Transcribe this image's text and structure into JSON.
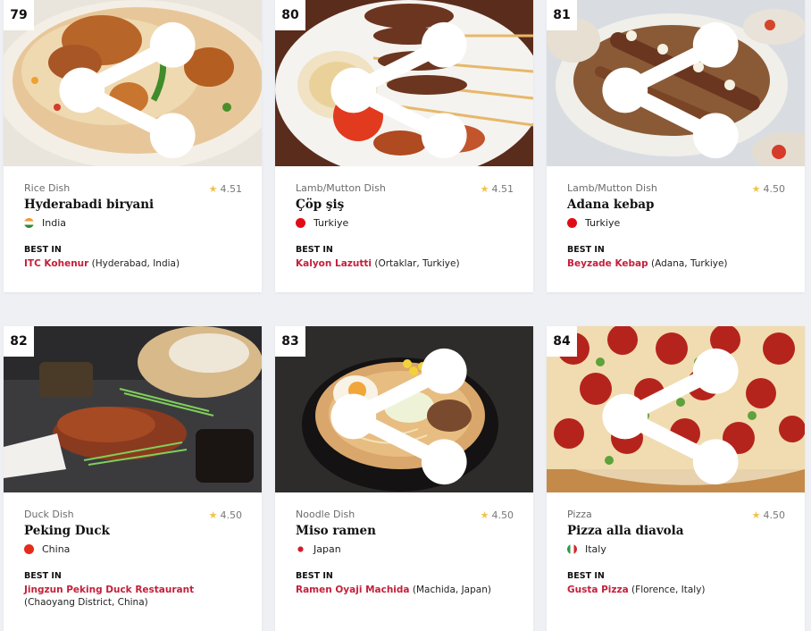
{
  "share_icon": "share-icon",
  "star_icon": "star-icon",
  "colors": {
    "accent": "#c4203a",
    "star": "#f2c24a"
  },
  "best_in_label": "BEST IN",
  "cards": [
    {
      "rank": "79",
      "category": "Rice Dish",
      "rating": "4.51",
      "name": "Hyderabadi biryani",
      "country": "India",
      "restaurant": "ITC Kohenur",
      "location": " (Hyderabad, India)"
    },
    {
      "rank": "80",
      "category": "Lamb/Mutton Dish",
      "rating": "4.51",
      "name": "Çöp şiş",
      "country": "Turkiye",
      "restaurant": "Kalyon Lazutti",
      "location": " (Ortaklar, Turkiye)"
    },
    {
      "rank": "81",
      "category": "Lamb/Mutton Dish",
      "rating": "4.50",
      "name": "Adana kebap",
      "country": "Turkiye",
      "restaurant": "Beyzade Kebap",
      "location": " (Adana, Turkiye)"
    },
    {
      "rank": "82",
      "category": "Duck Dish",
      "rating": "4.50",
      "name": "Peking Duck",
      "country": "China",
      "restaurant": "Jingzun Peking Duck Restaurant",
      "location": " (Chaoyang District, China)"
    },
    {
      "rank": "83",
      "category": "Noodle Dish",
      "rating": "4.50",
      "name": "Miso ramen",
      "country": "Japan",
      "restaurant": "Ramen Oyaji Machida",
      "location": " (Machida, Japan)"
    },
    {
      "rank": "84",
      "category": "Pizza",
      "rating": "4.50",
      "name": "Pizza alla diavola",
      "country": "Italy",
      "restaurant": "Gusta Pizza",
      "location": " (Florence, Italy)"
    }
  ]
}
